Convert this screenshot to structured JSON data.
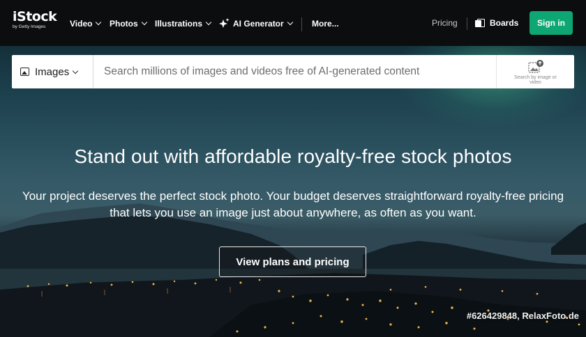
{
  "brand": {
    "name": "iStock",
    "tagline": "by Getty Images"
  },
  "nav": {
    "items": [
      {
        "label": "Video"
      },
      {
        "label": "Photos"
      },
      {
        "label": "Illustrations"
      },
      {
        "label": "AI Generator"
      }
    ],
    "more_label": "More...",
    "pricing_label": "Pricing",
    "boards_label": "Boards",
    "signin_label": "Sign in"
  },
  "search": {
    "type_label": "Images",
    "placeholder": "Search millions of images and videos free of AI-generated content",
    "search_by_image_label": "Search by image or video"
  },
  "hero": {
    "headline": "Stand out with affordable royalty-free stock photos",
    "subtext": "Your project deserves the perfect stock photo. Your budget deserves straightforward royalty-free pricing that lets you use an image just about anywhere, as often as you want.",
    "cta_label": "View plans and pricing",
    "photo_credit": "#626429848, RelaxFoto.de"
  },
  "colors": {
    "nav_bg": "#0c0d0f",
    "signin_bg": "#0ea774",
    "search_bg": "#ffffff"
  },
  "icons": {
    "search_type": "image-icon",
    "ai_generator": "sparkle-icon",
    "boards": "boards-icon",
    "search_by_image": "image-upload-icon"
  }
}
